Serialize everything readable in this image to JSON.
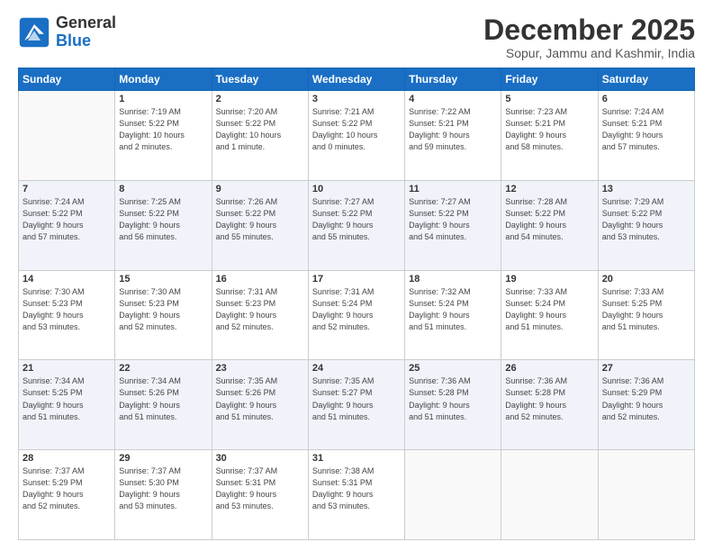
{
  "logo": {
    "line1": "General",
    "line2": "Blue"
  },
  "title": "December 2025",
  "subtitle": "Sopur, Jammu and Kashmir, India",
  "header": {
    "days": [
      "Sunday",
      "Monday",
      "Tuesday",
      "Wednesday",
      "Thursday",
      "Friday",
      "Saturday"
    ]
  },
  "weeks": [
    [
      {
        "day": "",
        "info": ""
      },
      {
        "day": "1",
        "info": "Sunrise: 7:19 AM\nSunset: 5:22 PM\nDaylight: 10 hours\nand 2 minutes."
      },
      {
        "day": "2",
        "info": "Sunrise: 7:20 AM\nSunset: 5:22 PM\nDaylight: 10 hours\nand 1 minute."
      },
      {
        "day": "3",
        "info": "Sunrise: 7:21 AM\nSunset: 5:22 PM\nDaylight: 10 hours\nand 0 minutes."
      },
      {
        "day": "4",
        "info": "Sunrise: 7:22 AM\nSunset: 5:21 PM\nDaylight: 9 hours\nand 59 minutes."
      },
      {
        "day": "5",
        "info": "Sunrise: 7:23 AM\nSunset: 5:21 PM\nDaylight: 9 hours\nand 58 minutes."
      },
      {
        "day": "6",
        "info": "Sunrise: 7:24 AM\nSunset: 5:21 PM\nDaylight: 9 hours\nand 57 minutes."
      }
    ],
    [
      {
        "day": "7",
        "info": "Sunrise: 7:24 AM\nSunset: 5:22 PM\nDaylight: 9 hours\nand 57 minutes."
      },
      {
        "day": "8",
        "info": "Sunrise: 7:25 AM\nSunset: 5:22 PM\nDaylight: 9 hours\nand 56 minutes."
      },
      {
        "day": "9",
        "info": "Sunrise: 7:26 AM\nSunset: 5:22 PM\nDaylight: 9 hours\nand 55 minutes."
      },
      {
        "day": "10",
        "info": "Sunrise: 7:27 AM\nSunset: 5:22 PM\nDaylight: 9 hours\nand 55 minutes."
      },
      {
        "day": "11",
        "info": "Sunrise: 7:27 AM\nSunset: 5:22 PM\nDaylight: 9 hours\nand 54 minutes."
      },
      {
        "day": "12",
        "info": "Sunrise: 7:28 AM\nSunset: 5:22 PM\nDaylight: 9 hours\nand 54 minutes."
      },
      {
        "day": "13",
        "info": "Sunrise: 7:29 AM\nSunset: 5:22 PM\nDaylight: 9 hours\nand 53 minutes."
      }
    ],
    [
      {
        "day": "14",
        "info": "Sunrise: 7:30 AM\nSunset: 5:23 PM\nDaylight: 9 hours\nand 53 minutes."
      },
      {
        "day": "15",
        "info": "Sunrise: 7:30 AM\nSunset: 5:23 PM\nDaylight: 9 hours\nand 52 minutes."
      },
      {
        "day": "16",
        "info": "Sunrise: 7:31 AM\nSunset: 5:23 PM\nDaylight: 9 hours\nand 52 minutes."
      },
      {
        "day": "17",
        "info": "Sunrise: 7:31 AM\nSunset: 5:24 PM\nDaylight: 9 hours\nand 52 minutes."
      },
      {
        "day": "18",
        "info": "Sunrise: 7:32 AM\nSunset: 5:24 PM\nDaylight: 9 hours\nand 51 minutes."
      },
      {
        "day": "19",
        "info": "Sunrise: 7:33 AM\nSunset: 5:24 PM\nDaylight: 9 hours\nand 51 minutes."
      },
      {
        "day": "20",
        "info": "Sunrise: 7:33 AM\nSunset: 5:25 PM\nDaylight: 9 hours\nand 51 minutes."
      }
    ],
    [
      {
        "day": "21",
        "info": "Sunrise: 7:34 AM\nSunset: 5:25 PM\nDaylight: 9 hours\nand 51 minutes."
      },
      {
        "day": "22",
        "info": "Sunrise: 7:34 AM\nSunset: 5:26 PM\nDaylight: 9 hours\nand 51 minutes."
      },
      {
        "day": "23",
        "info": "Sunrise: 7:35 AM\nSunset: 5:26 PM\nDaylight: 9 hours\nand 51 minutes."
      },
      {
        "day": "24",
        "info": "Sunrise: 7:35 AM\nSunset: 5:27 PM\nDaylight: 9 hours\nand 51 minutes."
      },
      {
        "day": "25",
        "info": "Sunrise: 7:36 AM\nSunset: 5:28 PM\nDaylight: 9 hours\nand 51 minutes."
      },
      {
        "day": "26",
        "info": "Sunrise: 7:36 AM\nSunset: 5:28 PM\nDaylight: 9 hours\nand 52 minutes."
      },
      {
        "day": "27",
        "info": "Sunrise: 7:36 AM\nSunset: 5:29 PM\nDaylight: 9 hours\nand 52 minutes."
      }
    ],
    [
      {
        "day": "28",
        "info": "Sunrise: 7:37 AM\nSunset: 5:29 PM\nDaylight: 9 hours\nand 52 minutes."
      },
      {
        "day": "29",
        "info": "Sunrise: 7:37 AM\nSunset: 5:30 PM\nDaylight: 9 hours\nand 53 minutes."
      },
      {
        "day": "30",
        "info": "Sunrise: 7:37 AM\nSunset: 5:31 PM\nDaylight: 9 hours\nand 53 minutes."
      },
      {
        "day": "31",
        "info": "Sunrise: 7:38 AM\nSunset: 5:31 PM\nDaylight: 9 hours\nand 53 minutes."
      },
      {
        "day": "",
        "info": ""
      },
      {
        "day": "",
        "info": ""
      },
      {
        "day": "",
        "info": ""
      }
    ]
  ]
}
